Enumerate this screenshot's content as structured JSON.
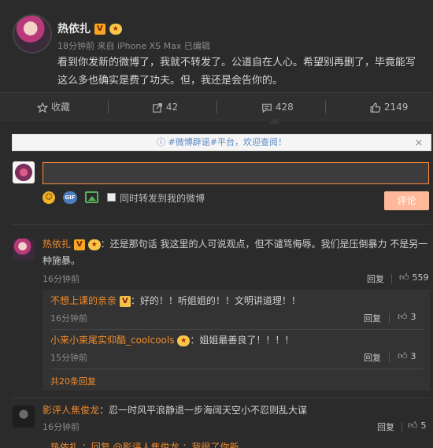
{
  "post": {
    "author": "热依扎",
    "time": "18分钟前",
    "source": "来自 iPhone XS Max",
    "edited": "已编辑",
    "text": "看到你发新的微博了，我就不转发了。公道自在人心。希望别再删了，毕竟能写这么多也确实是费了功夫。但，我还是会告你的。"
  },
  "actions": {
    "favorite": "收藏",
    "repost": "42",
    "comment": "428",
    "like": "2149"
  },
  "notice": {
    "text": "#微博辟谣#平台，欢迎查阅！",
    "close": "×"
  },
  "composer": {
    "input_value": "",
    "forward_label": "同时转发到我的微博",
    "submit_label": "评论"
  },
  "comments": [
    {
      "author": "热依扎",
      "text": "：还是那句话 我这里的人可说观点，但不谴骂侮辱。我们是压倒暴力 不是另一种施暴。",
      "time": "16分钟前",
      "reply": "回复",
      "likes": "559",
      "replies": [
        {
          "author": "不想上课的亲亲",
          "text": "：好的！！听姐姐的！！文明讲道理！！",
          "time": "16分钟前",
          "reply": "回复",
          "likes": "3"
        },
        {
          "author": "小来小束尾实仰酷_coolcools",
          "text": "：姐姐最善良了！！！！",
          "time": "15分钟前",
          "reply": "回复",
          "likes": "3"
        }
      ],
      "more_replies": "共20条回复"
    },
    {
      "author": "影评人焦俊龙",
      "text": "：忍一时风平浪静退一步海阔天空小不忍则乱大谋",
      "time": "16分钟前",
      "reply": "回复",
      "likes": "5"
    }
  ],
  "partial_row": {
    "text": "热依扎 ：回复 @影评人焦俊龙 ：我很了你新……"
  }
}
